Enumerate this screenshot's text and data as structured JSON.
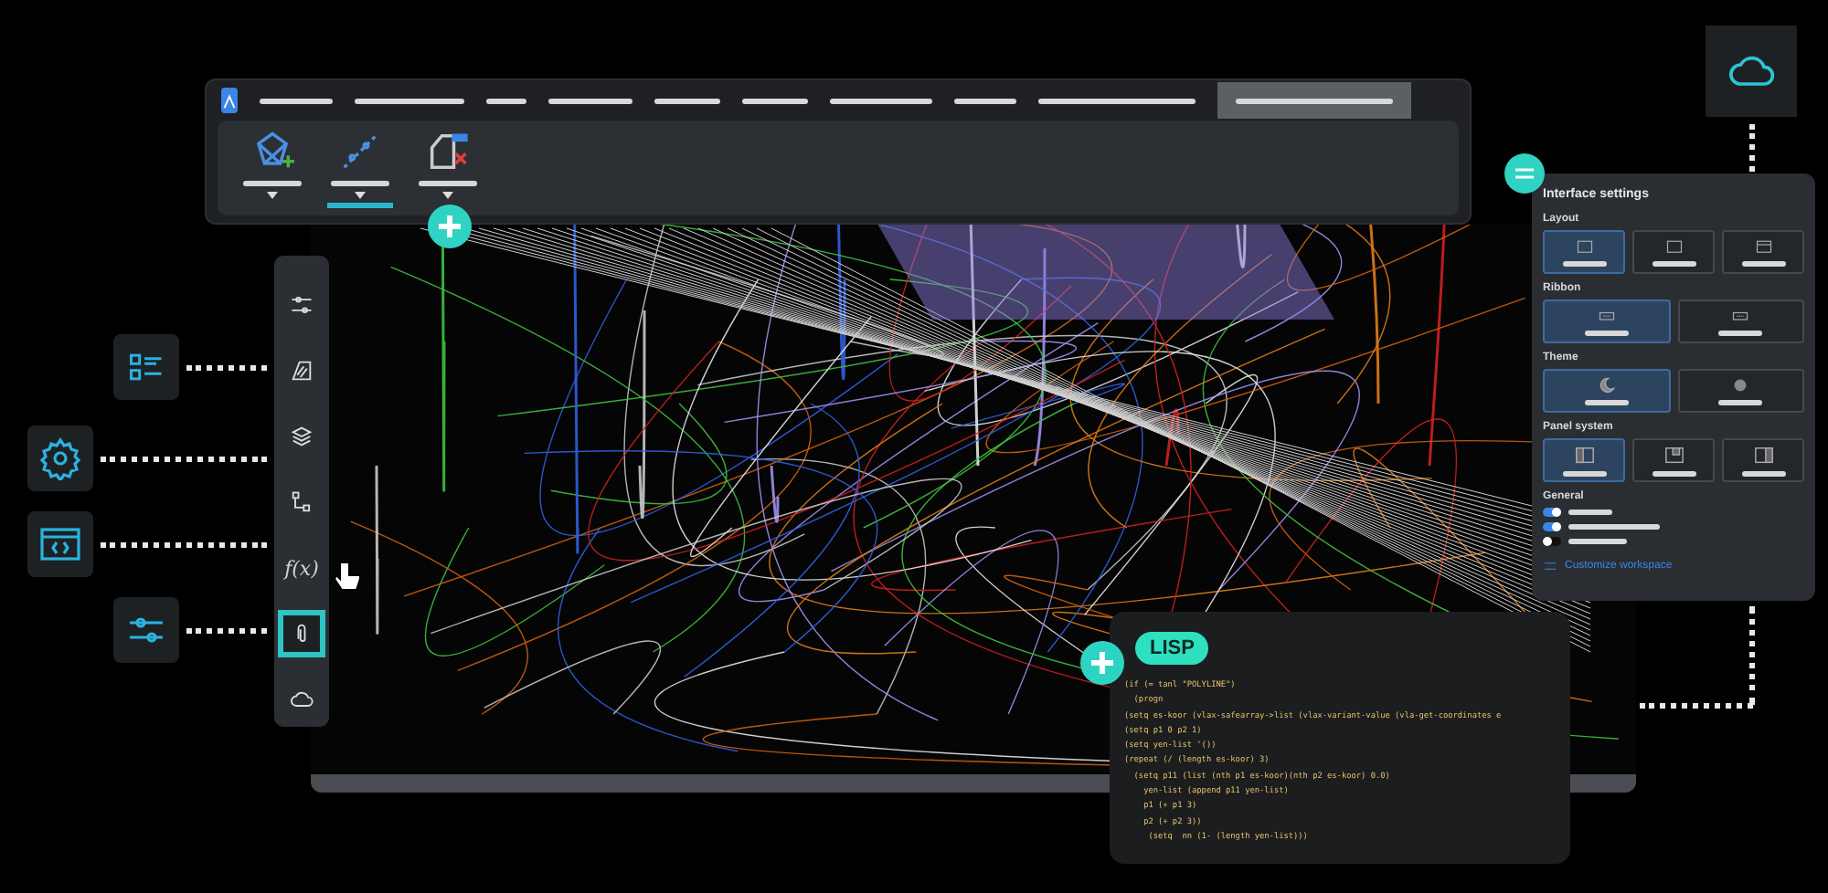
{
  "menu_bar": {
    "items": [
      {
        "selected": false
      },
      {
        "selected": false
      },
      {
        "selected": false
      },
      {
        "selected": false
      },
      {
        "selected": false
      },
      {
        "selected": false
      },
      {
        "selected": false
      },
      {
        "selected": false
      },
      {
        "selected": false
      },
      {
        "selected": true
      }
    ]
  },
  "ribbon": {
    "tools": [
      {
        "kind": "solid",
        "selected": false
      },
      {
        "kind": "points",
        "selected": true
      },
      {
        "kind": "delete",
        "selected": false
      }
    ]
  },
  "sidebar": {
    "items": [
      {
        "kind": "sliders",
        "selected": false
      },
      {
        "kind": "hatch",
        "selected": false
      },
      {
        "kind": "layers",
        "selected": false
      },
      {
        "kind": "tree",
        "selected": false
      },
      {
        "kind": "function",
        "label": "f(x)",
        "selected": false
      },
      {
        "kind": "attach",
        "selected": true
      },
      {
        "kind": "cloud",
        "selected": false
      }
    ]
  },
  "feature_tiles": [
    {
      "kind": "list"
    },
    {
      "kind": "settings"
    },
    {
      "kind": "code"
    },
    {
      "kind": "sliders"
    }
  ],
  "interface_settings": {
    "title": "Interface settings",
    "groups": [
      {
        "label": "Layout",
        "options": [
          {
            "kind": "dots",
            "selected": true
          },
          {
            "kind": "dots",
            "selected": false
          },
          {
            "kind": "window",
            "selected": false
          }
        ]
      },
      {
        "label": "Ribbon",
        "options": [
          {
            "kind": "ribbon",
            "selected": true
          },
          {
            "kind": "ribbon",
            "selected": false
          }
        ]
      },
      {
        "label": "Theme",
        "options": [
          {
            "kind": "moon",
            "selected": true
          },
          {
            "kind": "sun",
            "selected": false
          }
        ]
      },
      {
        "label": "Panel system",
        "options": [
          {
            "kind": "panel-left",
            "selected": true
          },
          {
            "kind": "panel-top",
            "selected": false
          },
          {
            "kind": "panel-right",
            "selected": false
          }
        ]
      }
    ],
    "general": {
      "label": "General",
      "toggles": [
        {
          "on": true
        },
        {
          "on": true
        },
        {
          "on": false
        }
      ]
    },
    "link": "Customize workspace"
  },
  "lisp_panel": {
    "badge": "LISP",
    "code": [
      "(if (= tanl \"POLYLINE\")",
      "  (progn",
      "(setq es-koor (vlax-safearray->list (vlax-variant-value (vla-get-coordinates e",
      "(setq p1 0 p2 1)",
      "(setq yen-list '())",
      "(repeat (/ (length es-koor) 3)",
      "  (setq p11 (list (nth p1 es-koor)(nth p2 es-koor) 0.0)",
      "    yen-list (append p11 yen-list)",
      "    p1 (+ p1 3)",
      "    p2 (+ p2 3))",
      "     (setq  nn (1- (length yen-list)))"
    ]
  }
}
